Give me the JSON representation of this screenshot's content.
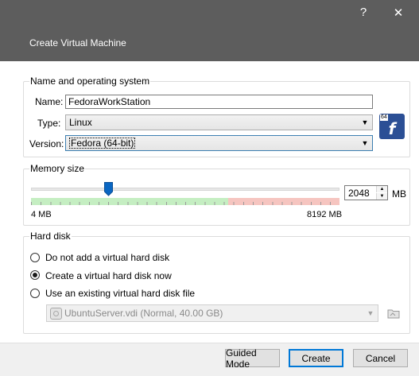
{
  "window": {
    "help_glyph": "?",
    "close_glyph": "✕",
    "dialog_title": "Create Virtual Machine"
  },
  "name_os": {
    "group_title": "Name and operating system",
    "name_label": "Name:",
    "name_value": "FedoraWorkStation",
    "type_label": "Type:",
    "type_value": "Linux",
    "version_label": "Version:",
    "version_value": "Fedora (64-bit)",
    "os_icon_badge": "64",
    "os_icon_glyph": "f"
  },
  "memory": {
    "group_title": "Memory size",
    "min_label": "4 MB",
    "max_label": "8192 MB",
    "value": "2048",
    "unit": "MB",
    "slider_fraction": 0.25,
    "recommended_fraction": 0.64,
    "green_color": "#c5eec2",
    "red_color": "#f6c5c0"
  },
  "hard_disk": {
    "group_title": "Hard disk",
    "options": [
      {
        "label": "Do not add a virtual hard disk",
        "checked": false
      },
      {
        "label": "Create a virtual hard disk now",
        "checked": true
      },
      {
        "label": "Use an existing virtual hard disk file",
        "checked": false
      }
    ],
    "existing_file": "UbuntuServer.vdi (Normal, 40.00 GB)"
  },
  "buttons": {
    "guided_mode": "Guided Mode",
    "create": "Create",
    "cancel": "Cancel"
  },
  "colors": {
    "header": "#5d5d5d",
    "default_button_border": "#0078d7"
  }
}
